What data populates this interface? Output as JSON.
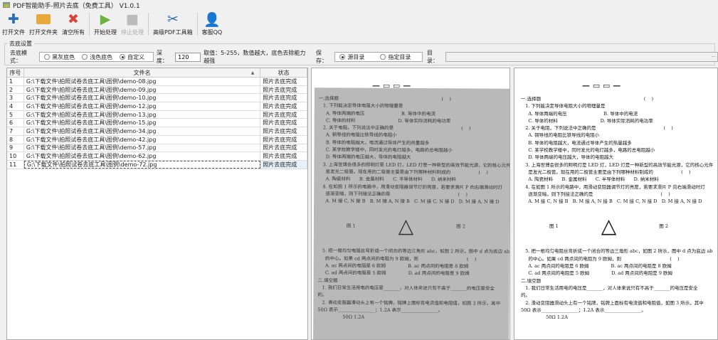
{
  "window": {
    "title": "PDF智能助手-照片去底（免费工具） V1.0.1"
  },
  "toolbar": [
    {
      "label": "打开文件",
      "icon": "plus-icon",
      "enabled": true
    },
    {
      "label": "打开文件夹",
      "icon": "folder-open-icon",
      "enabled": true
    },
    {
      "label": "清空所有",
      "icon": "close-icon",
      "enabled": true
    },
    {
      "label": "开始处理",
      "icon": "play-icon",
      "enabled": true
    },
    {
      "label": "停止处理",
      "icon": "stop-icon",
      "enabled": false
    },
    {
      "label": "高级PDF工具箱",
      "icon": "tools-icon",
      "enabled": true
    },
    {
      "label": "客服QQ",
      "icon": "user-icon",
      "enabled": true
    }
  ],
  "settings": {
    "group_title": "去底设置",
    "mode_label": "去底模式：",
    "modes": [
      "黑灰底色",
      "浅色底色",
      "自定义"
    ],
    "selected_mode": "自定义",
    "depth_label": "深度：",
    "depth_value": "120",
    "hint": "取值：5-255，数值越大，底色去除能力越强",
    "save_label": "保存：",
    "save_options": [
      "源目录",
      "指定目录"
    ],
    "selected_save": "源目录",
    "dir_label": "目录：",
    "dir_value": "",
    "browse": "..."
  },
  "table": {
    "headers": [
      "序号",
      "文件名",
      "状态"
    ],
    "rows": [
      {
        "no": "1",
        "file": "G:\\下载文件\\拍照试卷去底工具\\图例\\demo-08.jpg",
        "status": "照片去底完成"
      },
      {
        "no": "2",
        "file": "G:\\下载文件\\拍照试卷去底工具\\图例\\demo-09.jpg",
        "status": "照片去底完成"
      },
      {
        "no": "3",
        "file": "G:\\下载文件\\拍照试卷去底工具\\图例\\demo-10.jpg",
        "status": "照片去底完成"
      },
      {
        "no": "4",
        "file": "G:\\下载文件\\拍照试卷去底工具\\图例\\demo-12.jpg",
        "status": "照片去底完成"
      },
      {
        "no": "5",
        "file": "G:\\下载文件\\拍照试卷去底工具\\图例\\demo-13.jpg",
        "status": "照片去底完成"
      },
      {
        "no": "6",
        "file": "G:\\下载文件\\拍照试卷去底工具\\图例\\demo-15.jpg",
        "status": "照片去底完成"
      },
      {
        "no": "7",
        "file": "G:\\下载文件\\拍照试卷去底工具\\图例\\demo-34.jpg",
        "status": "照片去底完成"
      },
      {
        "no": "8",
        "file": "G:\\下载文件\\拍照试卷去底工具\\图例\\demo-42.jpg",
        "status": "照片去底完成"
      },
      {
        "no": "9",
        "file": "G:\\下载文件\\拍照试卷去底工具\\图例\\demo-57.jpg",
        "status": "照片去底完成"
      },
      {
        "no": "10",
        "file": "G:\\下载文件\\拍照试卷去底工具\\图例\\demo-62.jpg",
        "status": "照片去底完成"
      },
      {
        "no": "11",
        "file": "G:\\下载文件\\拍照试卷去底工具\\图例\\demo-72.jpg",
        "status": "照片去底完成"
      }
    ]
  },
  "preview": {
    "lines_top": [
      "一.选择题                                                                      (    )",
      "   1. 下列能决定导体电阻大小的物理量是",
      "     A. 导体两端的电压                         B. 导体中的电流",
      "     C. 导体的材料                             D. 导体实际消耗的电功率",
      "   2. 关于电阻，下列说法中正确的是                                              (    )",
      "     A. 铜导线的电阻比铁导线的电阻小",
      "     B. 导体的电阻越大，电流通过导体产生的热量越多",
      "     C. 某学校教学楼中，同时发光的电灯越多，电路的总电阻越小",
      "     D. 导体两端的电压越大，导体的电阻越大",
      "   3. 上海世博会很多的照明灯是 LED 灯，LED 灯是一种新型的高效节能光源，它的核心元件",
      "     是发光二极管。现在用的二极管主要是由下列哪种材料制成的                   (    )",
      "     A. 陶瓷材料      B. 金属材料      C. 半导体材料      D. 纳米材料",
      "   4. 在如图 1 所示的电路中，用滑动变阻器调节灯的亮度，若要求滑片 P 向右端滑动时灯",
      "     逐渐变暗，则下列接法正确的是                                              (    )",
      "     A. M 接 C, N 接 B   B. M 接 A, N 接 B   C. M 接 C, N 接 D   D. M 接 A, N 接 D"
    ],
    "fig1": "图 1",
    "fig2": "图 2",
    "lines_bottom": [
      "   5. 把一根均匀电阻丝弯折成一个闭合的等边三角形 abc，如图 2 所示，图中 d 点为底边 ab",
      "     的中心。如果 cd 两点间的电阻为 9 欧姆，则                                 (    )",
      "     A. ac 两点间的电阻是 6 欧姆               B. ac 两点间的电阻是 8 欧姆",
      "     C. ad 两点间的电阻是 5 欧姆               D. ad 两点间的电阻是 9 欧姆",
      "二.填空题",
      "   1. 我们日常生活用电的电压是_______，对人体来说只有不高于_______的电压是安全",
      "的。",
      "   2. 滑动变阻器滑动头上有一个铭牌，铭牌上面标有电流值和电阻值，如图 3 所示，其中",
      "50Ω 表示________________；1.2A 表示________________。",
      "                 50Ω 1.2A"
    ]
  },
  "colors": {
    "plus": "#2a6fb5",
    "folder": "#e8a83a",
    "close": "#d9453a",
    "play": "#6db33f",
    "stop": "#bbbbbb",
    "tools": "#2a6fb5",
    "user": "#2a6fb5"
  }
}
